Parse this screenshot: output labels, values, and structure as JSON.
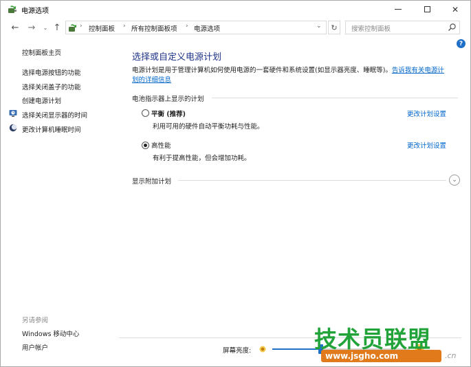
{
  "window": {
    "title": "电源选项",
    "controls": {
      "minimize_icon": "minimize-icon",
      "maximize_icon": "maximize-icon",
      "close_icon": "close-icon",
      "close_label": "✕"
    }
  },
  "navigation": {
    "back_glyph": "←",
    "forward_glyph": "→",
    "recent_glyph": "⌄",
    "up_glyph": "↑",
    "breadcrumbs": [
      "控制面板",
      "所有控制面板项",
      "电源选项"
    ],
    "separator": "›",
    "dropdown_glyph": "⌄",
    "refresh_glyph": "↻",
    "search_placeholder": "搜索控制面板"
  },
  "help": {
    "label": "?"
  },
  "sidebar": {
    "home_link": "控制面板主页",
    "links": [
      "选择电源按钮的功能",
      "选择关闭盖子的功能",
      "创建电源计划",
      "选择关闭显示器的时间",
      "更改计算机睡眠时间"
    ],
    "see_also_title": "另请参阅",
    "see_also_links": [
      "Windows 移动中心",
      "用户帐户"
    ]
  },
  "main": {
    "title": "选择或自定义电源计划",
    "description_line1": "电源计划是用于管理计算机如何使用电源的一套硬件和系统设置(如显示器亮度、睡眠等)。",
    "description_link1": "告诉我有关电源计",
    "description_link2": "划的详细信息",
    "section_battery": "电池指示器上显示的计划",
    "plans": [
      {
        "name": "平衡 (推荐)",
        "description": "利用可用的硬件自动平衡功耗与性能。",
        "link": "更改计划设置",
        "selected": false
      },
      {
        "name": "高性能",
        "description": "有利于提高性能，但会增加功耗。",
        "link": "更改计划设置",
        "selected": true
      }
    ],
    "section_additional": "显示附加计划",
    "expand_glyph": "⌄"
  },
  "bottom": {
    "brightness_label": "屏幕亮度:",
    "brightness_level": 0.35
  },
  "watermark": {
    "text": "技术员联盟",
    "url": "www.jsgho.com",
    "suffix": ".cn"
  },
  "colors": {
    "accent": "#1e6fc8",
    "link": "#0066cc",
    "title": "#1e3287",
    "watermark_green": "#22a33a",
    "watermark_orange": "#e07a1a"
  }
}
